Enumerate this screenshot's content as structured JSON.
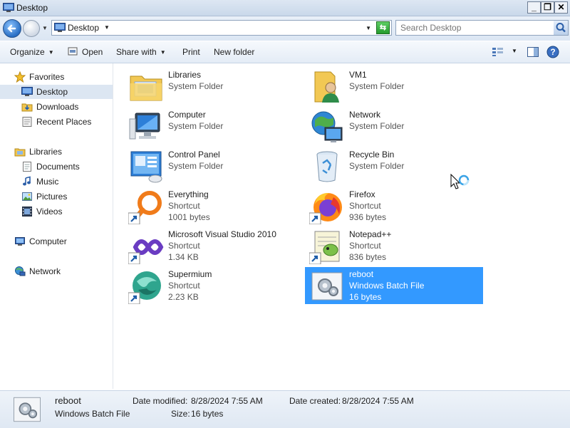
{
  "window": {
    "title": "Desktop"
  },
  "titlebar_buttons": {
    "minimize": "_",
    "maximize": "❐",
    "close": "✕"
  },
  "address": {
    "crumb": "Desktop"
  },
  "search": {
    "placeholder": "Search Desktop"
  },
  "toolbar": {
    "organize": "Organize",
    "open": "Open",
    "share_with": "Share with",
    "print": "Print",
    "new_folder": "New folder"
  },
  "nav": {
    "favorites": {
      "label": "Favorites",
      "items": [
        "Desktop",
        "Downloads",
        "Recent Places"
      ]
    },
    "libraries": {
      "label": "Libraries",
      "items": [
        "Documents",
        "Music",
        "Pictures",
        "Videos"
      ]
    },
    "computer": "Computer",
    "network": "Network"
  },
  "items": [
    {
      "name": "Libraries",
      "line2": "System Folder",
      "icon": "libraries-folder-icon"
    },
    {
      "name": "VM1",
      "line2": "System Folder",
      "icon": "user-folder-icon"
    },
    {
      "name": "Computer",
      "line2": "System Folder",
      "icon": "computer-icon"
    },
    {
      "name": "Network",
      "line2": "System Folder",
      "icon": "network-globe-icon"
    },
    {
      "name": "Control Panel",
      "line2": "System Folder",
      "icon": "control-panel-icon"
    },
    {
      "name": "Recycle Bin",
      "line2": "System Folder",
      "icon": "recycle-bin-icon"
    },
    {
      "name": "Everything",
      "line2": "Shortcut",
      "line3": "1001 bytes",
      "icon": "everything-app-icon"
    },
    {
      "name": "Firefox",
      "line2": "Shortcut",
      "line3": "936 bytes",
      "icon": "firefox-icon"
    },
    {
      "name": "Microsoft Visual Studio 2010",
      "line2": "Shortcut",
      "line3": "1.34 KB",
      "icon": "visual-studio-icon"
    },
    {
      "name": "Notepad++",
      "line2": "Shortcut",
      "line3": "836 bytes",
      "icon": "notepad-plus-plus-icon"
    },
    {
      "name": "Supermium",
      "line2": "Shortcut",
      "line3": "2.23 KB",
      "icon": "supermium-icon"
    },
    {
      "name": "reboot",
      "line2": "Windows Batch File",
      "line3": "16 bytes",
      "icon": "batch-file-icon",
      "selected": true
    }
  ],
  "details": {
    "name": "reboot",
    "type": "Windows Batch File",
    "date_modified_label": "Date modified:",
    "date_modified": "8/28/2024 7:55 AM",
    "size_label": "Size:",
    "size": "16 bytes",
    "date_created_label": "Date created:",
    "date_created": "8/28/2024 7:55 AM"
  },
  "colors": {
    "selection": "#3399ff",
    "nav_selected": "#dce6f2",
    "titlebar": "#dde7f3"
  }
}
